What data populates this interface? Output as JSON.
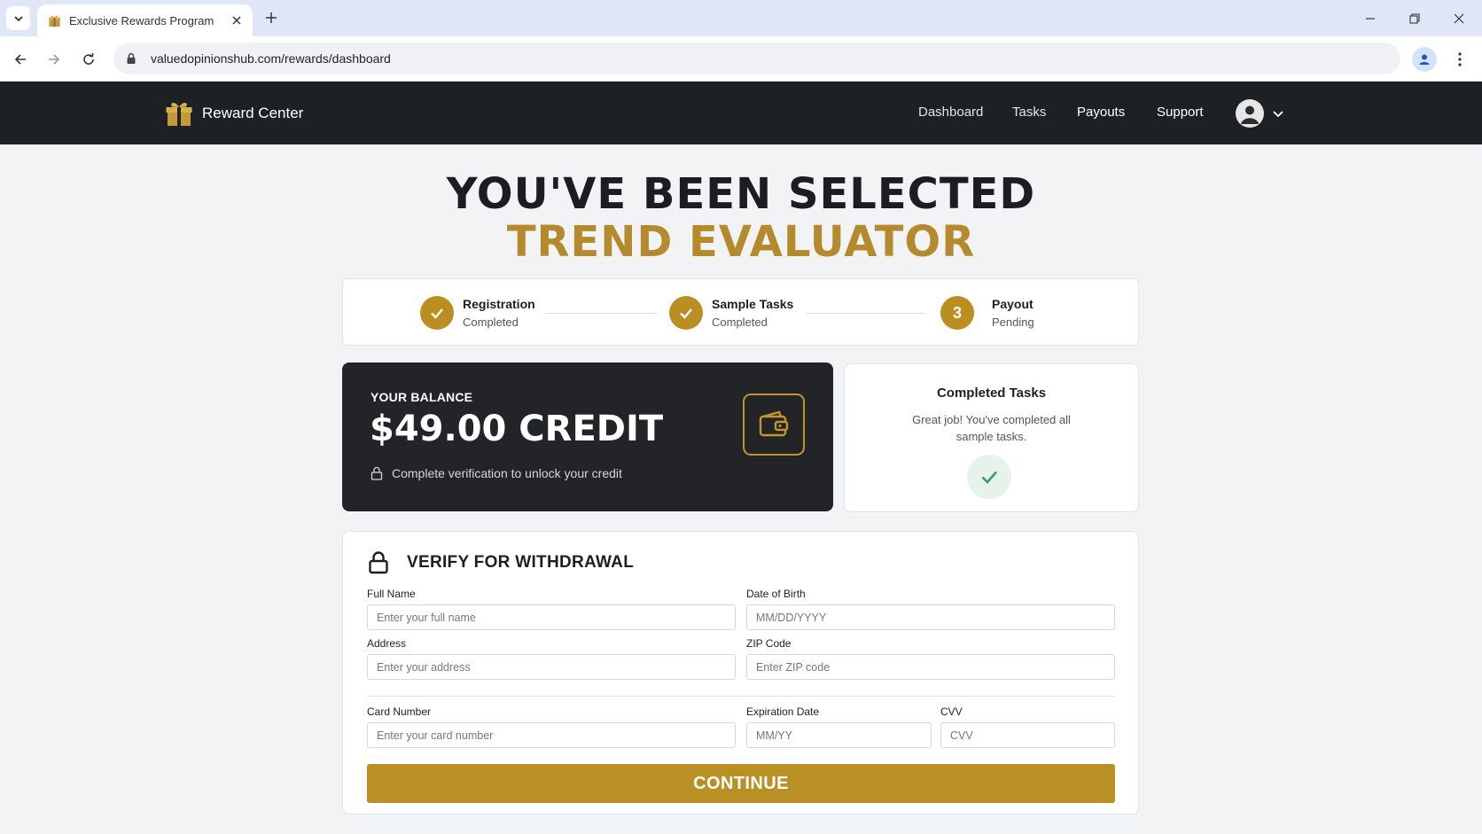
{
  "browser": {
    "tab_title": "Exclusive Rewards Program",
    "url": "valuedopinionshub.com/rewards/dashboard"
  },
  "header": {
    "brand": "Reward Center",
    "nav": [
      "Dashboard",
      "Tasks",
      "Payouts",
      "Support"
    ]
  },
  "headline": {
    "line1": "YOU'VE BEEN SELECTED",
    "line2": "TREND EVALUATOR"
  },
  "steps": [
    {
      "title": "Registration",
      "status": "Completed"
    },
    {
      "title": "Sample Tasks",
      "status": "Completed"
    },
    {
      "number": "3",
      "title": "Payout",
      "status": "Pending"
    }
  ],
  "balance": {
    "label": "YOUR BALANCE",
    "amount": "$49.00 CREDIT",
    "note": "Complete verification to unlock your credit"
  },
  "tasks_card": {
    "title": "Completed Tasks",
    "message": "Great job! You've completed all sample tasks."
  },
  "verify": {
    "title": "VERIFY FOR WITHDRAWAL",
    "fields": {
      "full_name": {
        "label": "Full Name",
        "placeholder": "Enter your full name"
      },
      "dob": {
        "label": "Date of Birth",
        "placeholder": "MM/DD/YYYY"
      },
      "address": {
        "label": "Address",
        "placeholder": "Enter your address"
      },
      "zip": {
        "label": "ZIP Code",
        "placeholder": "Enter ZIP code"
      },
      "card": {
        "label": "Card Number",
        "placeholder": "Enter your card number"
      },
      "exp": {
        "label": "Expiration Date",
        "placeholder": "MM/YY"
      },
      "cvv": {
        "label": "CVV",
        "placeholder": "CVV"
      }
    },
    "submit": "CONTINUE"
  },
  "colors": {
    "gold": "#b89024",
    "dark": "#1e2124",
    "success": "#3d9a5c"
  },
  "icons": {
    "brand": "gift-icon",
    "balance": "wallet-icon",
    "lock": "lock-icon",
    "check": "check-icon"
  }
}
